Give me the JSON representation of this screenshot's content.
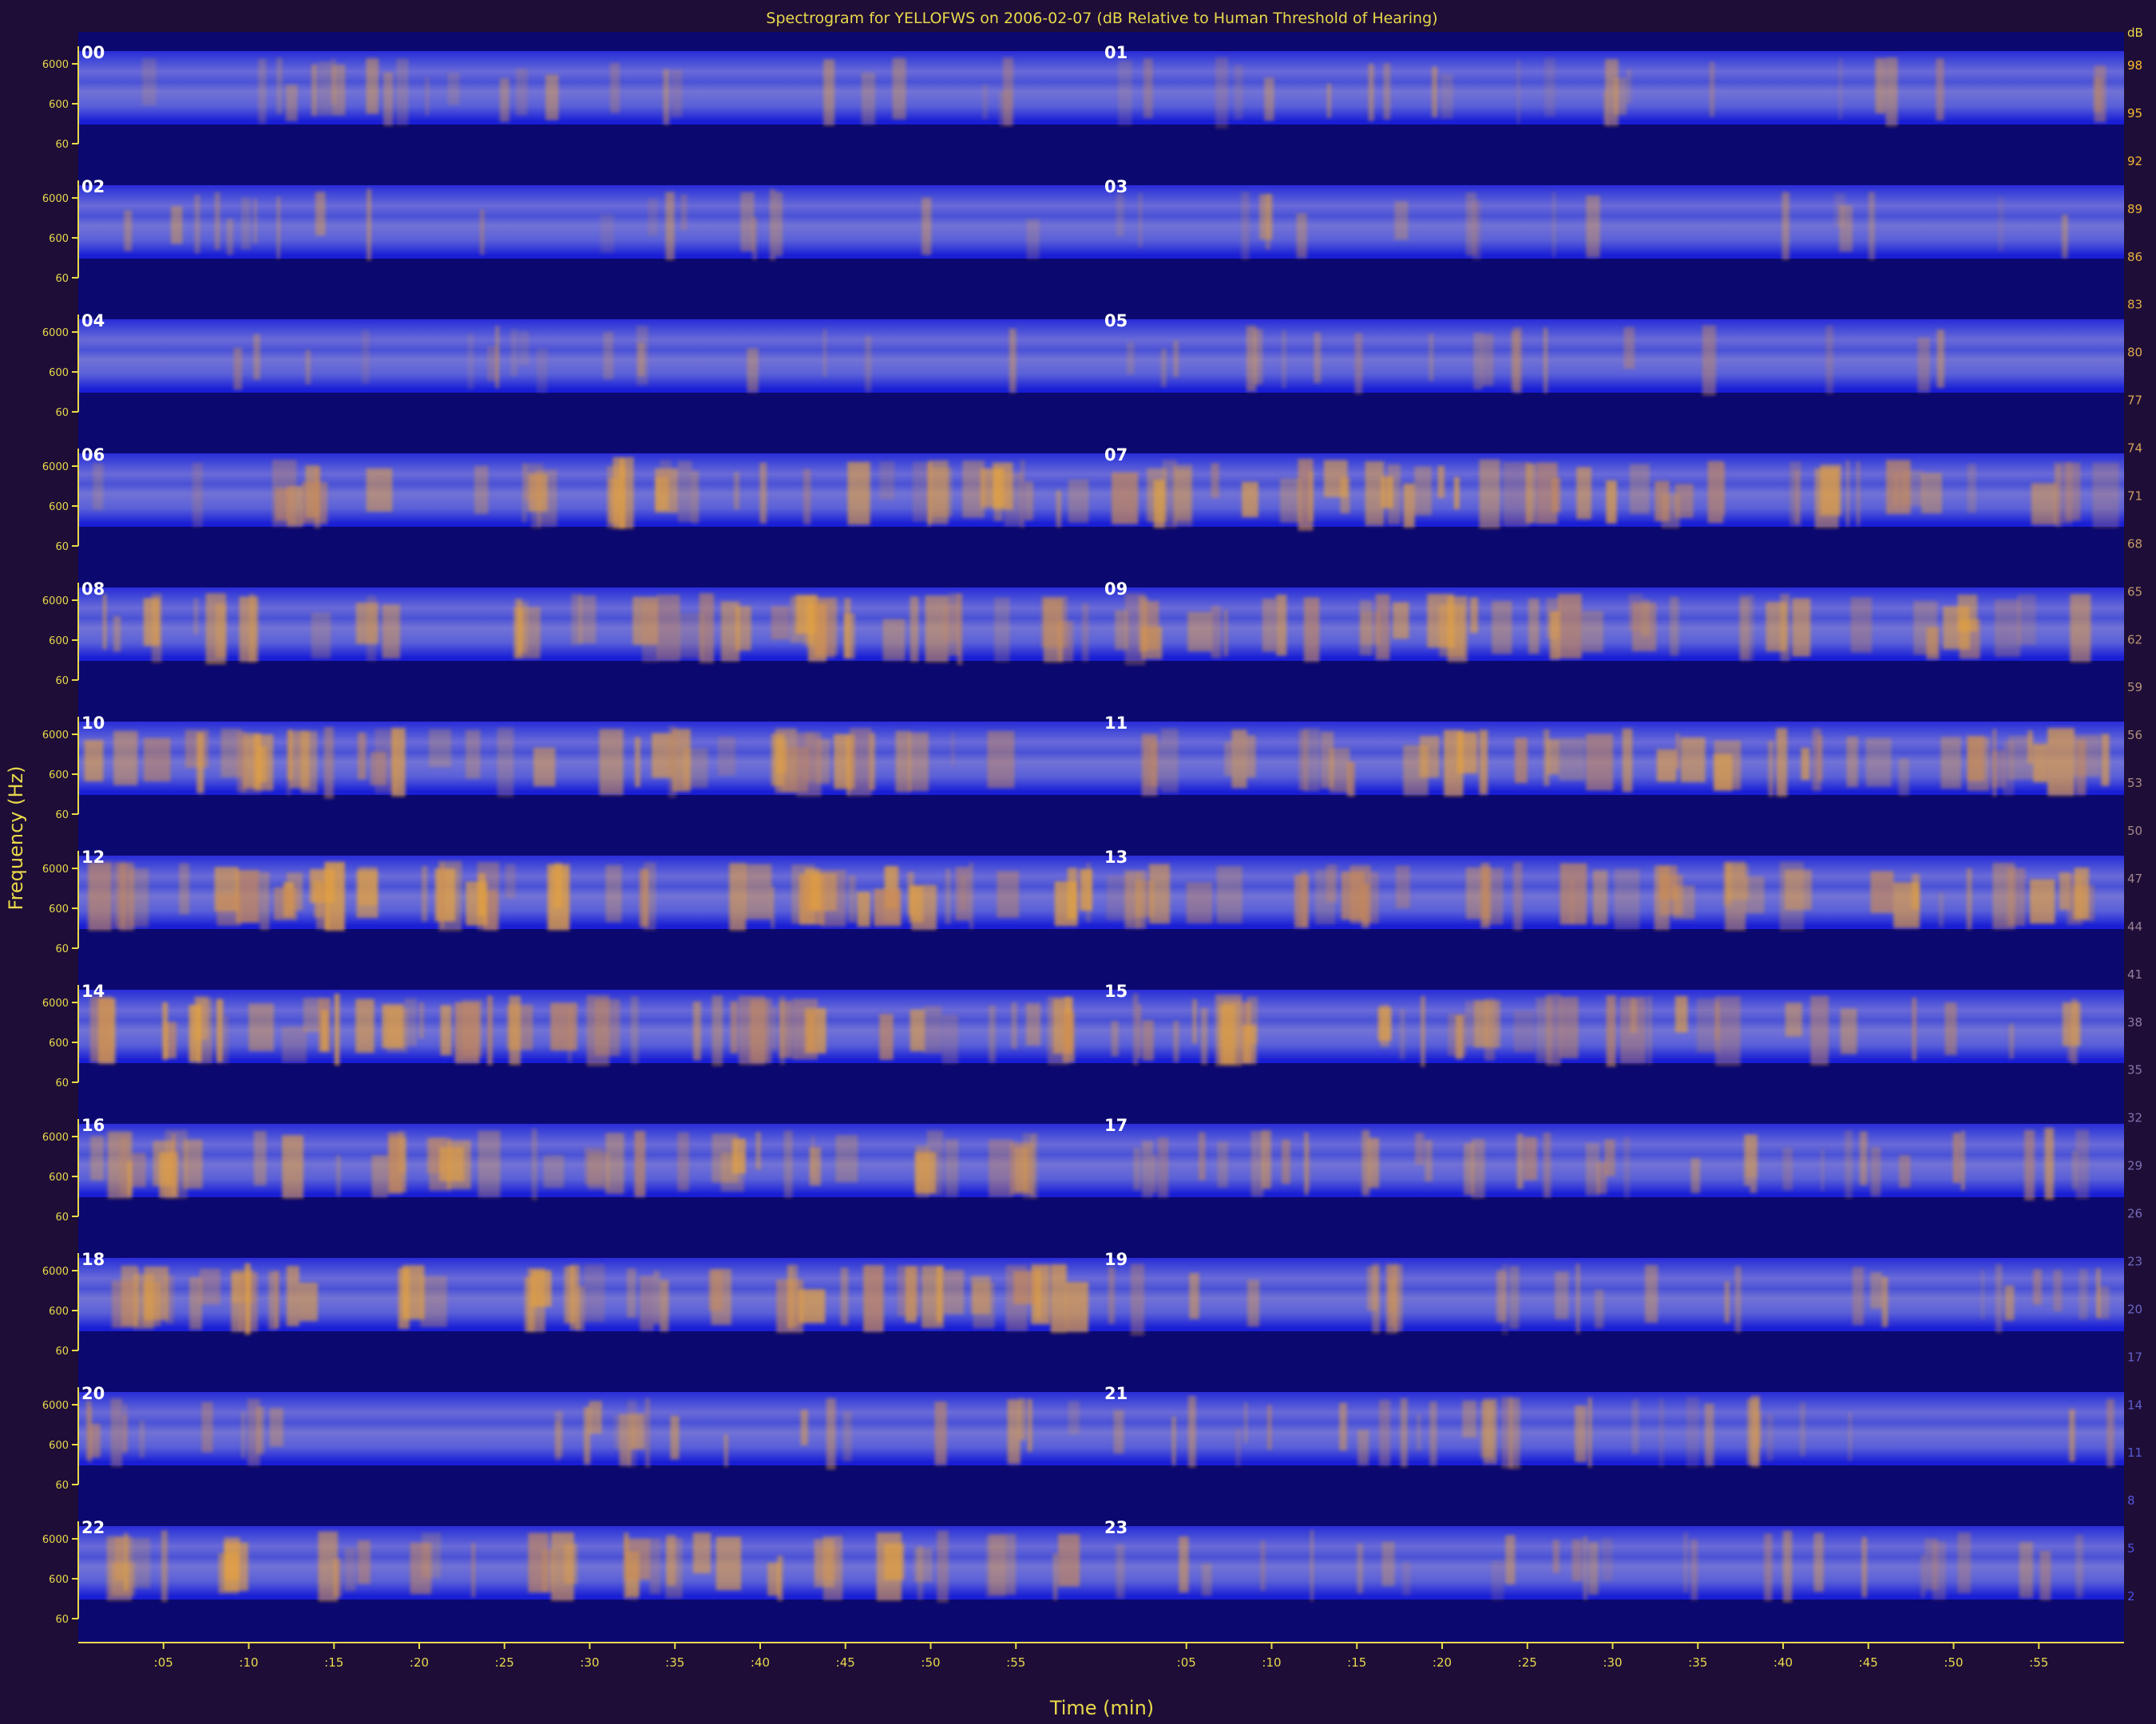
{
  "chart_data": {
    "type": "heatmap",
    "title": "Spectrogram for YELLOFWS on 2006-02-07 (dB Relative to Human Threshold of Hearing)",
    "xlabel": "Time (min)",
    "ylabel": "Frequency (Hz)",
    "hour_panels": [
      "00",
      "01",
      "02",
      "03",
      "04",
      "05",
      "06",
      "07",
      "08",
      "09",
      "10",
      "11",
      "12",
      "13",
      "14",
      "15",
      "16",
      "17",
      "18",
      "19",
      "20",
      "21",
      "22",
      "23"
    ],
    "frequency_tick_labels": [
      "6000",
      "600",
      "60"
    ],
    "time_tick_labels": [
      ":05",
      ":10",
      ":15",
      ":20",
      ":25",
      ":30",
      ":35",
      ":40",
      ":45",
      ":50",
      ":55"
    ],
    "colorbar": {
      "label": "dB",
      "ticks": [
        98,
        95,
        92,
        89,
        86,
        83,
        80,
        77,
        74,
        71,
        68,
        65,
        62,
        59,
        56,
        53,
        50,
        47,
        44,
        41,
        38,
        35,
        32,
        29,
        26,
        23,
        20,
        17,
        14,
        11,
        8,
        5,
        2
      ],
      "low_color": "#1010c0",
      "high_color": "#ffb400"
    },
    "hourly_activity": [
      {
        "hour": "00",
        "level": 0.25
      },
      {
        "hour": "01",
        "level": 0.22
      },
      {
        "hour": "02",
        "level": 0.18
      },
      {
        "hour": "03",
        "level": 0.12
      },
      {
        "hour": "04",
        "level": 0.12
      },
      {
        "hour": "05",
        "level": 0.15
      },
      {
        "hour": "06",
        "level": 0.55
      },
      {
        "hour": "07",
        "level": 0.65
      },
      {
        "hour": "08",
        "level": 0.6
      },
      {
        "hour": "09",
        "level": 0.55
      },
      {
        "hour": "10",
        "level": 0.6
      },
      {
        "hour": "11",
        "level": 0.65
      },
      {
        "hour": "12",
        "level": 0.8
      },
      {
        "hour": "13",
        "level": 0.6
      },
      {
        "hour": "14",
        "level": 0.75
      },
      {
        "hour": "15",
        "level": 0.55
      },
      {
        "hour": "16",
        "level": 0.6
      },
      {
        "hour": "17",
        "level": 0.5
      },
      {
        "hour": "18",
        "level": 0.7
      },
      {
        "hour": "19",
        "level": 0.35
      },
      {
        "hour": "20",
        "level": 0.35
      },
      {
        "hour": "21",
        "level": 0.35
      },
      {
        "hour": "22",
        "level": 0.55
      },
      {
        "hour": "23",
        "level": 0.3
      }
    ],
    "grid": false
  },
  "colors": {
    "background": "#1e0d37",
    "plot_background": "#0b0870",
    "axis": "#e8d94a",
    "band_dark": "#1a1fbf",
    "band_light": "#5560e0",
    "noise_orange": "#e0a040"
  }
}
